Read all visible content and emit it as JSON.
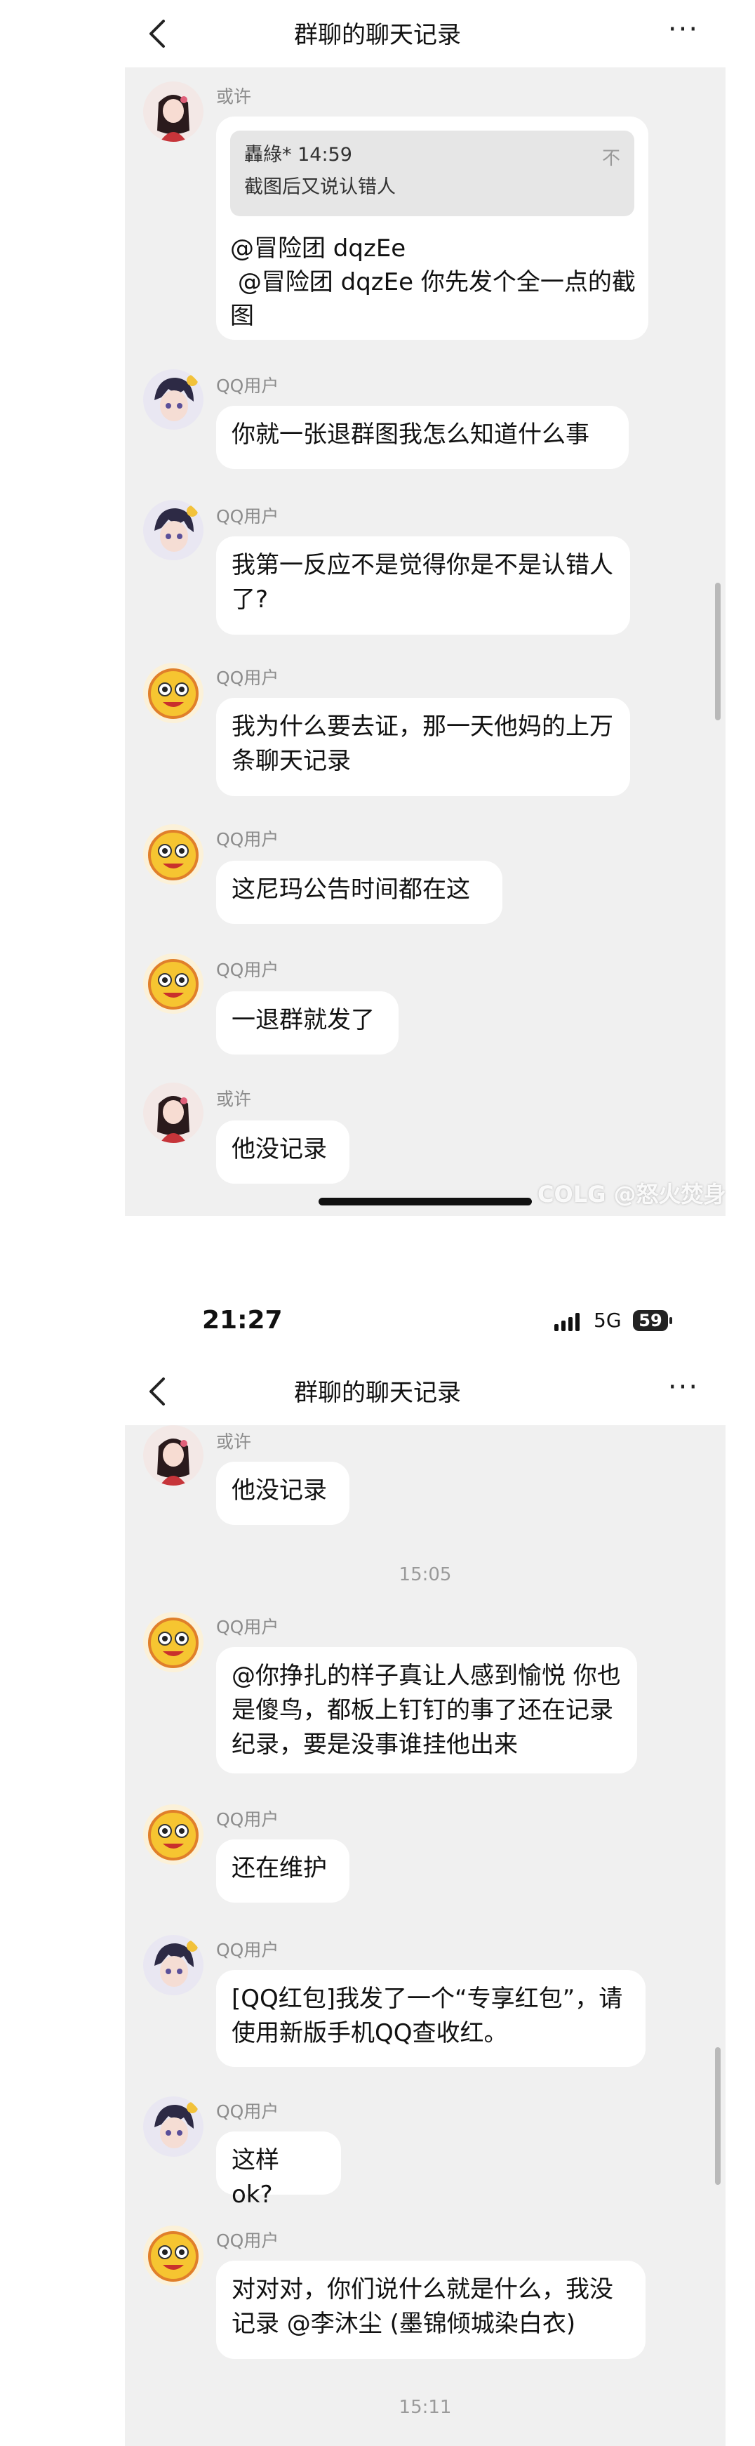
{
  "screen1": {
    "title": "群聊的聊天记录",
    "more": "···",
    "messages": [
      {
        "nick": "或许",
        "quote_author": "轟綠* 14:59",
        "quote_text": "截图后又说认错人",
        "quote_icon": "不",
        "text": "@冒险团 dqzEe\n @冒险团 dqzEe 你先发个全一点的截图"
      },
      {
        "nick": "QQ用户",
        "text": "你就一张退群图我怎么知道什么事"
      },
      {
        "nick": "QQ用户",
        "text": "我第一反应不是觉得你是不是认错人了?"
      },
      {
        "nick": "QQ用户",
        "text": "我为什么要去证，那一天他妈的上万条聊天记录"
      },
      {
        "nick": "QQ用户",
        "text": "这尼玛公告时间都在这"
      },
      {
        "nick": "QQ用户",
        "text": "一退群就发了"
      },
      {
        "nick": "或许",
        "text": "他没记录"
      }
    ],
    "watermark": "COLG @怒火焚身"
  },
  "status": {
    "time": "21:27",
    "network": "5G",
    "battery": "59"
  },
  "screen2": {
    "title": "群聊的聊天记录",
    "more": "···",
    "messages": [
      {
        "nick": "或许",
        "text": "他没记录"
      },
      {
        "time": "15:05"
      },
      {
        "nick": "QQ用户",
        "text": "@你挣扎的样子真让人感到愉悦 你也是傻鸟，都板上钉钉的事了还在记录纪录，要是没事谁挂他出来"
      },
      {
        "nick": "QQ用户",
        "text": "还在维护"
      },
      {
        "nick": "QQ用户",
        "text": "[QQ红包]我发了一个“专享红包”，请使用新版手机QQ查收红。"
      },
      {
        "nick": "QQ用户",
        "text": "这样 ok?"
      },
      {
        "nick": "QQ用户",
        "text": "对对对，你们说什么就是什么，我没记录 @李沐尘 (墨锦倾城染白衣)"
      },
      {
        "time": "15:11"
      }
    ]
  }
}
